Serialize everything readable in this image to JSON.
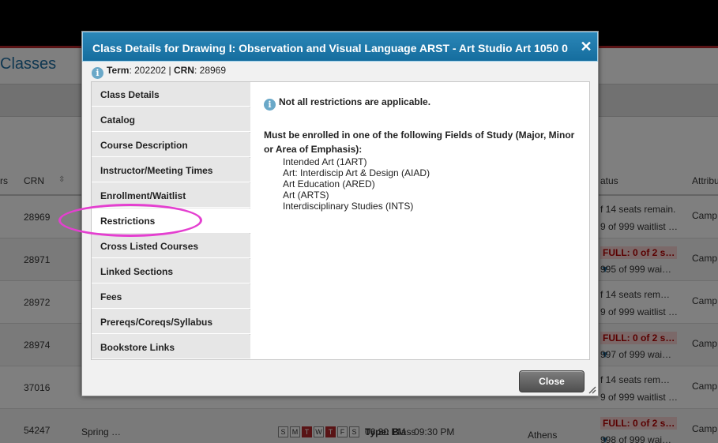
{
  "background": {
    "page_title": "Classes",
    "columns": {
      "hrs_fragment": "rs",
      "crn": "CRN",
      "status_fragment": "atus",
      "attribute_fragment": "Attribu"
    },
    "rows": [
      {
        "crn": "28969",
        "term": "",
        "status_line1": "f 14 seats remain.",
        "status_line2": "9 of 999 waitlist …",
        "full_label": "",
        "camp": "Camp"
      },
      {
        "crn": "28971",
        "term": "",
        "status_line1": "FULL: 0 of 2 s…",
        "status_line2": "995 of 999 wai…",
        "full_label": "FULL",
        "camp": "Camp"
      },
      {
        "crn": "28972",
        "term": "",
        "status_line1": "f 14 seats rem…",
        "status_line2": "9 of 999 waitlist …",
        "full_label": "",
        "camp": "Camp"
      },
      {
        "crn": "28974",
        "term": "",
        "status_line1": "FULL: 0 of 2 s…",
        "status_line2": "997 of 999 wai…",
        "full_label": "FULL",
        "camp": "Camp"
      },
      {
        "crn": "37016",
        "term": "",
        "status_line1": "f 14 seats rem…",
        "status_line2": "9 of 999 waitlist …",
        "full_label": "",
        "camp": "Camp"
      },
      {
        "crn": "54247",
        "term": "Spring …",
        "status_line1": "FULL: 0 of 2 s…",
        "status_line2": "998 of 999 wai…",
        "full_label": "FULL",
        "camp": "Camp"
      }
    ],
    "last_row_days": [
      "S",
      "M",
      "T",
      "W",
      "T",
      "F",
      "S"
    ],
    "last_row_time": "06:30 PM - 09:30 PM",
    "last_row_type_label": "Type:",
    "last_row_type_value": "Class",
    "last_row_type_suffix": "B",
    "last_row_location": "Athens"
  },
  "dialog": {
    "title": "Class Details for Drawing I: Observation and Visual Language ARST - Art Studio Art 1050 0",
    "term_label": "Term",
    "term_value": "202202",
    "crn_label": "CRN",
    "crn_value": "28969",
    "tabs": [
      "Class Details",
      "Catalog",
      "Course Description",
      "Instructor/Meeting Times",
      "Enrollment/Waitlist",
      "Restrictions",
      "Cross Listed Courses",
      "Linked Sections",
      "Fees",
      "Prereqs/Coreqs/Syllabus",
      "Bookstore Links"
    ],
    "active_tab": "Restrictions",
    "notice": "Not all restrictions are applicable.",
    "fields_title": "Must be enrolled in one of the following Fields of Study (Major, Minor or Area of Emphasis):",
    "fields": [
      "Intended Art (1ART)",
      "Art: Interdiscip Art & Design (AIAD)",
      "Art Education (ARED)",
      "Art (ARTS)",
      "Interdisciplinary Studies (INTS)"
    ],
    "close_label": "Close",
    "close_icon": "close-x-icon"
  },
  "colors": {
    "title_bar": "#1f7aab",
    "highlight": "#e43fd0",
    "full_red": "#b40000",
    "brand_red": "#b3262b"
  }
}
